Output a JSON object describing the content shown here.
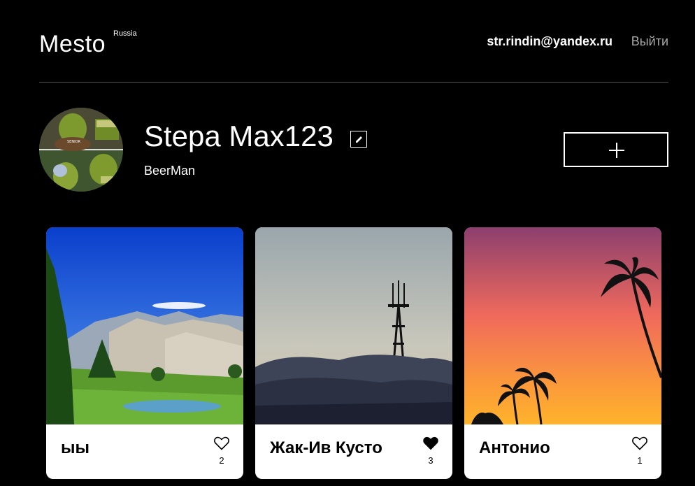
{
  "header": {
    "logo": "Mesto",
    "logo_superscript": "Russia",
    "email": "str.rindin@yandex.ru",
    "logout": "Выйти"
  },
  "profile": {
    "name": "Stepa Max123",
    "about": "BeerMan",
    "avatar_icon": "avatar-image",
    "edit_icon": "pencil-icon",
    "add_icon": "plus-icon"
  },
  "cards": [
    {
      "title": "ыы",
      "likes": "2",
      "liked": false
    },
    {
      "title": "Жак-Ив Кусто",
      "likes": "3",
      "liked": true
    },
    {
      "title": "Антонио",
      "likes": "1",
      "liked": false
    }
  ],
  "colors": {
    "background": "#000000",
    "divider": "#545454",
    "logout_text": "#a9a9a9",
    "card_background": "#ffffff"
  }
}
